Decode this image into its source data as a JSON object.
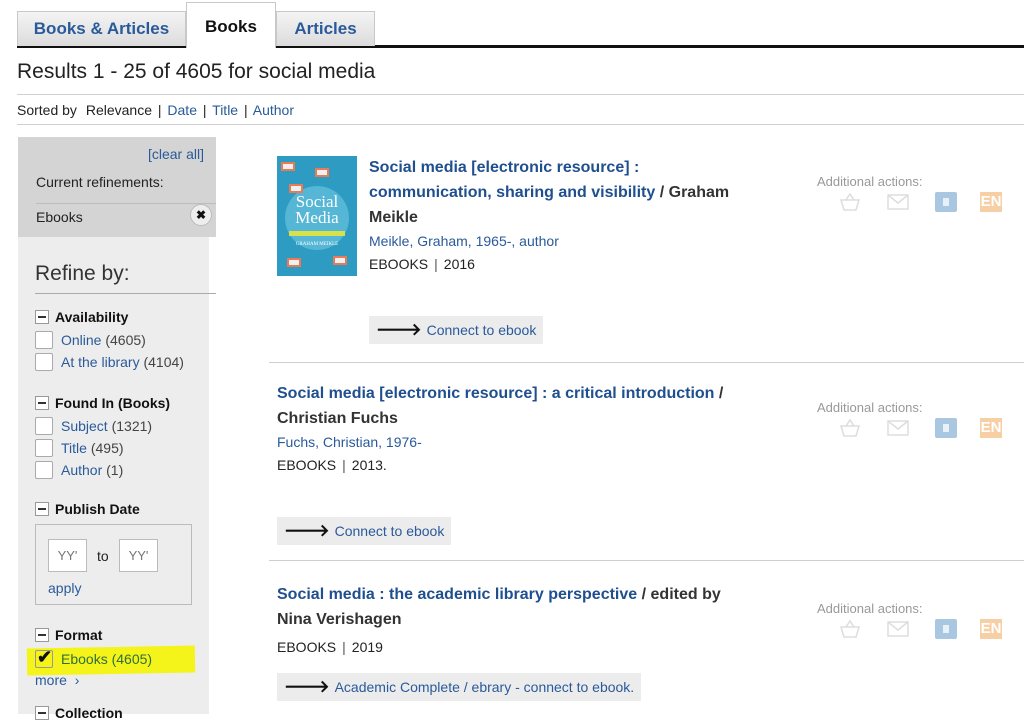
{
  "tabs": [
    {
      "label": "Books & Articles",
      "active": false
    },
    {
      "label": "Books",
      "active": true
    },
    {
      "label": "Articles",
      "active": false
    }
  ],
  "results_heading": "Results 1 - 25 of 4605 for social media",
  "sort": {
    "label": "Sorted by",
    "current": "Relevance",
    "options": [
      "Date",
      "Title",
      "Author"
    ],
    "separator": "|"
  },
  "sidebar": {
    "clear_all": "[clear all]",
    "current_refinements_label": "Current refinements:",
    "current_refinements": [
      {
        "label": "Ebooks",
        "remove_icon": "close-icon"
      }
    ],
    "refine_title": "Refine by:",
    "facets": {
      "availability": {
        "title": "Availability",
        "items": [
          {
            "label": "Online",
            "count": "(4605)",
            "checked": false
          },
          {
            "label": "At the library",
            "count": "(4104)",
            "checked": false
          }
        ]
      },
      "found_in": {
        "title": "Found In (Books)",
        "items": [
          {
            "label": "Subject",
            "count": "(1321)",
            "checked": false
          },
          {
            "label": "Title",
            "count": "(495)",
            "checked": false
          },
          {
            "label": "Author",
            "count": "(1)",
            "checked": false
          }
        ]
      },
      "publish_date": {
        "title": "Publish Date",
        "from_placeholder": "YY'",
        "to_label": "to",
        "to_placeholder": "YY'",
        "apply": "apply"
      },
      "format": {
        "title": "Format",
        "items": [
          {
            "label": "Ebooks",
            "count": "(4605)",
            "checked": true
          }
        ],
        "more": "more",
        "more_icon": "chevron-right-icon"
      },
      "next_title_partial": "Collection"
    },
    "highlight_color": "#f4f41a"
  },
  "results": [
    {
      "title": "Social media [electronic resource] : communication, sharing and visibility",
      "title_line1": "Social media [electronic resource] :",
      "title_line2": "communication, sharing and visibility",
      "responsibility_sep": " / ",
      "responsibility": "Graham",
      "responsibility_line2": "Meikle",
      "author": "Meikle, Graham, 1965-, author",
      "format": "EBOOKS",
      "year": "2016",
      "cover": {
        "title_line1": "Social",
        "title_line2": "Media",
        "author": "GRAHAM MEIKLE"
      },
      "connect_label": "Connect to ebook",
      "additional_actions_label": "Additional actions:",
      "actions": [
        "basket-icon",
        "mail-icon",
        "document-icon",
        "endnote-icon"
      ],
      "endnote_text": "EN"
    },
    {
      "title_line1": "Social media [electronic resource] : a critical introduction",
      "responsibility_sep": " /",
      "responsibility_line2": "Christian Fuchs",
      "author": "Fuchs, Christian, 1976-",
      "format": "EBOOKS",
      "year": "2013.",
      "connect_label": "Connect to ebook",
      "additional_actions_label": "Additional actions:",
      "endnote_text": "EN"
    },
    {
      "title_line1": "Social media : the academic library perspective",
      "responsibility_sep": " / ",
      "responsibility": "edited by",
      "responsibility_line2": "Nina Verishagen",
      "format": "EBOOKS",
      "year": "2019",
      "connect_label": "Academic Complete / ebrary - connect to ebook.",
      "additional_actions_label": "Additional actions:",
      "endnote_text": "EN"
    }
  ],
  "colors": {
    "link": "#2a5a9a",
    "title_link": "#1f4f8f",
    "sidebar_bg": "#ededed",
    "refinements_bg": "#d4d4d4",
    "endnote": "#f7cfa5",
    "document": "#aac7e2"
  }
}
